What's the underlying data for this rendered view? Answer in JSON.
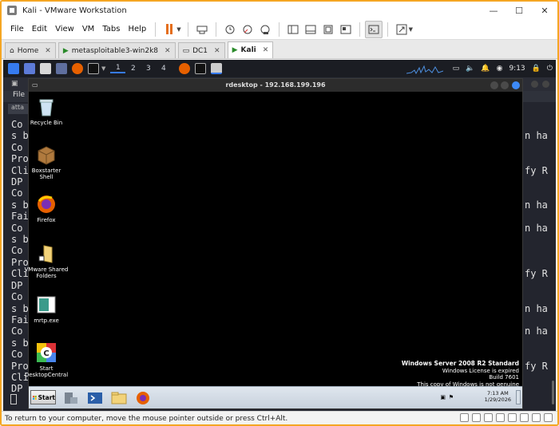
{
  "window": {
    "title": "Kali - VMware Workstation"
  },
  "menu": [
    "File",
    "Edit",
    "View",
    "VM",
    "Tabs",
    "Help"
  ],
  "tabs": [
    {
      "label": "Home",
      "active": false
    },
    {
      "label": "metasploitable3-win2k8",
      "active": false
    },
    {
      "label": "DC1",
      "active": false
    },
    {
      "label": "Kali",
      "active": true
    }
  ],
  "kali_panel": {
    "workspaces": [
      "1",
      "2",
      "3",
      "4"
    ],
    "clock": "9:13"
  },
  "terminal": {
    "menu_label": "File",
    "tab_label": "atta",
    "left_lines": [
      "Co",
      "s b",
      "Co",
      "Pro",
      "Cli",
      "DP",
      "Co",
      "s b",
      "Fai",
      "Co",
      "s b",
      "Co",
      "Pro",
      "Cli",
      "DP",
      "Co",
      "s b",
      "Fai",
      "Co",
      "s b",
      "Co",
      "Pro",
      "Cli",
      "DP"
    ],
    "right_lines": [
      "",
      "n ha",
      "",
      "",
      "fy R",
      "",
      "",
      "n ha",
      "",
      "n ha",
      "",
      "",
      "",
      "fy R",
      "",
      "",
      "n ha",
      "",
      "n ha",
      "",
      "",
      "fy R",
      "",
      ""
    ]
  },
  "rdesktop": {
    "title": "rdesktop - 192.168.199.196",
    "icons": [
      {
        "label": "Recycle Bin"
      },
      {
        "label": "Boxstarter\nShell"
      },
      {
        "label": "Firefox"
      },
      {
        "label": "VMware Shared\nFolders"
      },
      {
        "label": "mrtp.exe"
      },
      {
        "label": "Start\nDesktopCentral"
      }
    ],
    "watermark": {
      "line1": "Windows Server 2008 R2 Standard",
      "line2": "Windows License is expired",
      "line3": "Build 7601",
      "line4": "This copy of Windows is not genuine"
    },
    "taskbar": {
      "start_label": "Start",
      "time": "7:13 AM",
      "date": "1/29/2026"
    }
  },
  "status": {
    "message": "To return to your computer, move the mouse pointer outside or press Ctrl+Alt."
  },
  "colors": {
    "frame_accent": "#f5a623",
    "kali_panel": "#1b1d23",
    "active_workspace": "#367bf0",
    "pause": "#e46f1e"
  }
}
